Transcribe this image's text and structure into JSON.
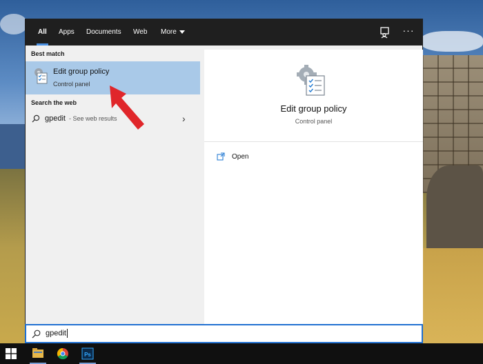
{
  "tabs": [
    {
      "label": "All",
      "active": true
    },
    {
      "label": "Apps"
    },
    {
      "label": "Documents"
    },
    {
      "label": "Web"
    },
    {
      "label": "More"
    }
  ],
  "left": {
    "best_match_label": "Best match",
    "best_match": {
      "title": "Edit group policy",
      "subtitle": "Control panel"
    },
    "search_web_label": "Search the web",
    "web_result": {
      "term": "gpedit",
      "suffix": "- See web results"
    }
  },
  "preview": {
    "title": "Edit group policy",
    "subtitle": "Control panel",
    "actions": [
      {
        "label": "Open"
      }
    ]
  },
  "search": {
    "value": "gpedit"
  },
  "taskbar": {
    "apps": [
      "file-explorer",
      "chrome",
      "photoshop"
    ],
    "ps_label": "Ps"
  },
  "colors": {
    "accent": "#1f6fd1",
    "highlight": "#a9c9e8",
    "arrow": "#e0262a",
    "topbar": "#1f1f1f"
  }
}
